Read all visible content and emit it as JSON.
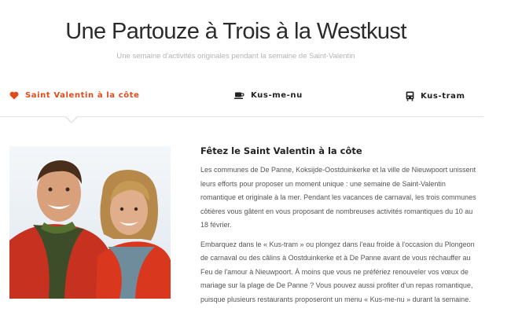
{
  "page": {
    "title": "Une Partouze à Trois à la Westkust",
    "subtitle": "Une semaine d'activités originales pendant la semaine de Saint-Valentin"
  },
  "tabs": [
    {
      "label": "Saint Valentin à la côte",
      "icon": "heart-icon",
      "active": true
    },
    {
      "label": "Kus-me-nu",
      "icon": "coffee-cup-icon",
      "active": false
    },
    {
      "label": "Kus-tram",
      "icon": "tram-icon",
      "active": false
    }
  ],
  "colors": {
    "accent": "#e24a1a",
    "text": "#555555",
    "heading": "#222222",
    "divider": "#e2e2e2"
  },
  "article": {
    "heading": "Fêtez le Saint Valentin à la côte",
    "paragraph1": "Les communes de De Panne, Koksijde-Oostduinkerke et la ville de Nieuwpoort unissent leurs efforts pour proposer un moment unique : une semaine de Saint-Valentin romantique et originale à la mer. Pendant les vacances de carnaval, les trois communes côtières vous gâtent en vous proposant de nombreuses activités romantiques du 10 au 18 février.",
    "paragraph2": "Embarquez dans le « Kus-tram » ou plongez dans l'eau froide à l'occasion du Plongeon de carnaval ou des câlins à Oostduinkerke et à De Panne avant de vous réchauffer au Feu de l'amour à Nieuwpoort. À moins que vous ne préfériez renouveler vos vœux de mariage sur la plage de De Panne ? Vous pouvez aussi profiter d'un repas romantique, puisque plusieurs restaurants proposeront un menu « Kus-me-nu » durant la semaine."
  }
}
